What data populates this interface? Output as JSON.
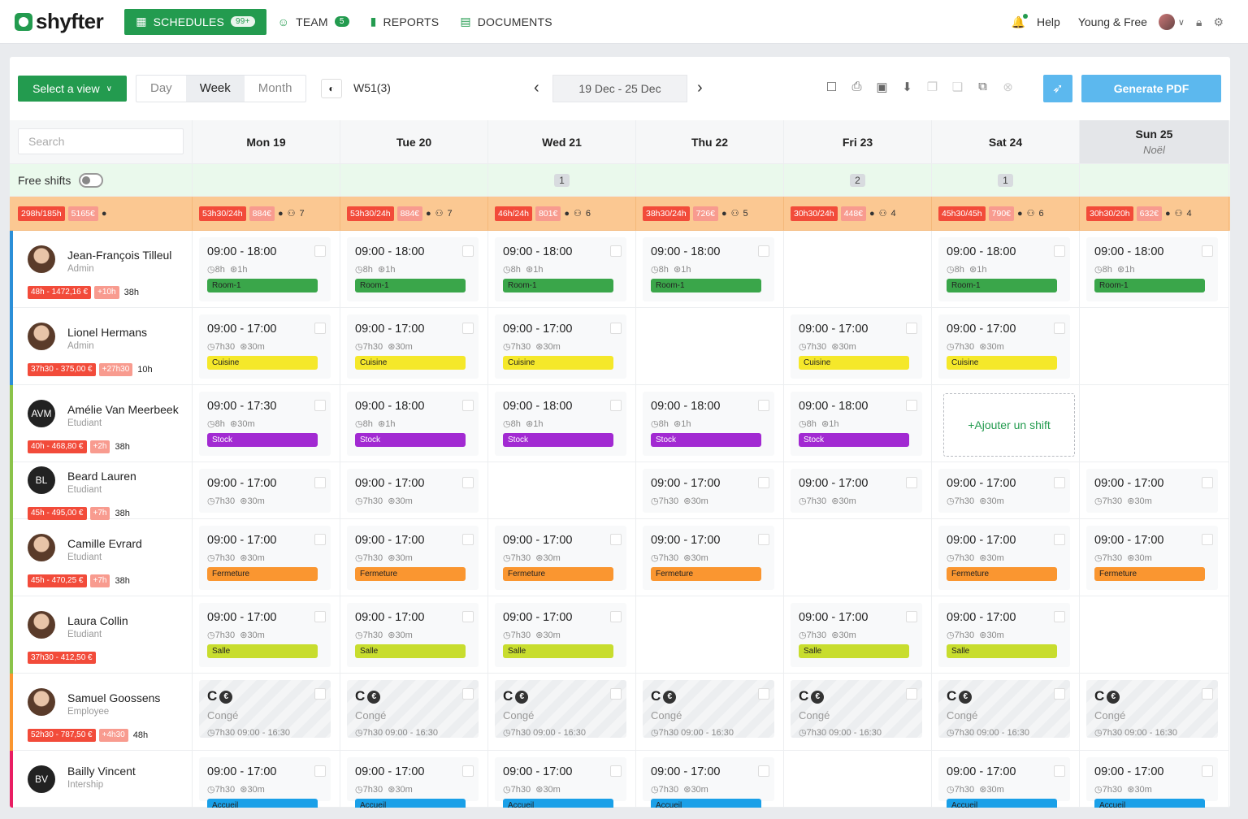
{
  "nav": {
    "logo": "shyfter",
    "schedules": "SCHEDULES",
    "schedules_badge": "99+",
    "team": "TEAM",
    "team_badge": "5",
    "reports": "REPORTS",
    "documents": "DOCUMENTS",
    "help": "Help",
    "org": "Young & Free"
  },
  "toolbar": {
    "select_view": "Select a view",
    "day": "Day",
    "week": "Week",
    "month": "Month",
    "week_label": "W51(3)",
    "date_range": "19 Dec - 25 Dec",
    "generate_pdf": "Generate PDF"
  },
  "search_placeholder": "Search",
  "free_shifts": "Free shifts",
  "days": [
    {
      "label": "Mon 19",
      "sub": "",
      "free": ""
    },
    {
      "label": "Tue 20",
      "sub": "",
      "free": ""
    },
    {
      "label": "Wed 21",
      "sub": "",
      "free": "1"
    },
    {
      "label": "Thu 22",
      "sub": "",
      "free": ""
    },
    {
      "label": "Fri 23",
      "sub": "",
      "free": "2"
    },
    {
      "label": "Sat 24",
      "sub": "",
      "free": "1"
    },
    {
      "label": "Sun 25",
      "sub": "Noël",
      "free": ""
    }
  ],
  "totals": {
    "hours": "298h/185h",
    "cost": "5165€"
  },
  "day_stats": [
    {
      "hours": "53h30/24h",
      "cost": "884€",
      "people": "7"
    },
    {
      "hours": "53h30/24h",
      "cost": "884€",
      "people": "7"
    },
    {
      "hours": "46h/24h",
      "cost": "801€",
      "people": "6"
    },
    {
      "hours": "38h30/24h",
      "cost": "726€",
      "people": "5"
    },
    {
      "hours": "30h30/24h",
      "cost": "448€",
      "people": "4"
    },
    {
      "hours": "45h30/45h",
      "cost": "790€",
      "people": "6"
    },
    {
      "hours": "30h30/20h",
      "cost": "632€",
      "people": "4"
    }
  ],
  "add_shift": "+Ajouter un shift",
  "employees": [
    {
      "name": "Jean-François Tilleul",
      "role": "Admin",
      "initials": "",
      "tags": [
        "48h - 1472,16 €",
        "+10h"
      ],
      "contract": "38h",
      "color": "#2b8fd8",
      "h": 95,
      "shifts": [
        {
          "t": "09:00 - 18:00",
          "d": "8h",
          "b": "1h",
          "l": "Room-1",
          "c": "green"
        },
        {
          "t": "09:00 - 18:00",
          "d": "8h",
          "b": "1h",
          "l": "Room-1",
          "c": "green"
        },
        {
          "t": "09:00 - 18:00",
          "d": "8h",
          "b": "1h",
          "l": "Room-1",
          "c": "green"
        },
        {
          "t": "09:00 - 18:00",
          "d": "8h",
          "b": "1h",
          "l": "Room-1",
          "c": "green"
        },
        null,
        {
          "t": "09:00 - 18:00",
          "d": "8h",
          "b": "1h",
          "l": "Room-1",
          "c": "green"
        },
        {
          "t": "09:00 - 18:00",
          "d": "8h",
          "b": "1h",
          "l": "Room-1",
          "c": "green"
        }
      ]
    },
    {
      "name": "Lionel Hermans",
      "role": "Admin",
      "initials": "",
      "tags": [
        "37h30 - 375,00 €",
        "+27h30"
      ],
      "contract": "10h",
      "color": "#2b8fd8",
      "h": 95,
      "shifts": [
        {
          "t": "09:00 - 17:00",
          "d": "7h30",
          "b": "30m",
          "l": "Cuisine",
          "c": "yellow"
        },
        {
          "t": "09:00 - 17:00",
          "d": "7h30",
          "b": "30m",
          "l": "Cuisine",
          "c": "yellow"
        },
        {
          "t": "09:00 - 17:00",
          "d": "7h30",
          "b": "30m",
          "l": "Cuisine",
          "c": "yellow"
        },
        null,
        {
          "t": "09:00 - 17:00",
          "d": "7h30",
          "b": "30m",
          "l": "Cuisine",
          "c": "yellow"
        },
        {
          "t": "09:00 - 17:00",
          "d": "7h30",
          "b": "30m",
          "l": "Cuisine",
          "c": "yellow"
        },
        null
      ]
    },
    {
      "name": "Amélie Van Meerbeek",
      "role": "Etudiant",
      "initials": "AVM",
      "tags": [
        "40h - 468,80 €",
        "+2h"
      ],
      "contract": "38h",
      "color": "#8bc34a",
      "h": 95,
      "shifts": [
        {
          "t": "09:00 - 17:30",
          "d": "8h",
          "b": "30m",
          "l": "Stock",
          "c": "purple"
        },
        {
          "t": "09:00 - 18:00",
          "d": "8h",
          "b": "1h",
          "l": "Stock",
          "c": "purple"
        },
        {
          "t": "09:00 - 18:00",
          "d": "8h",
          "b": "1h",
          "l": "Stock",
          "c": "purple"
        },
        {
          "t": "09:00 - 18:00",
          "d": "8h",
          "b": "1h",
          "l": "Stock",
          "c": "purple"
        },
        {
          "t": "09:00 - 18:00",
          "d": "8h",
          "b": "1h",
          "l": "Stock",
          "c": "purple"
        },
        "add",
        null
      ]
    },
    {
      "name": "Beard Lauren",
      "role": "Etudiant",
      "initials": "BL",
      "tags": [
        "45h - 495,00 €",
        "+7h"
      ],
      "contract": "38h",
      "color": "#8bc34a",
      "h": 70,
      "shifts": [
        {
          "t": "09:00 - 17:00",
          "d": "7h30",
          "b": "30m",
          "l": "",
          "c": ""
        },
        {
          "t": "09:00 - 17:00",
          "d": "7h30",
          "b": "30m",
          "l": "",
          "c": ""
        },
        null,
        {
          "t": "09:00 - 17:00",
          "d": "7h30",
          "b": "30m",
          "l": "",
          "c": ""
        },
        {
          "t": "09:00 - 17:00",
          "d": "7h30",
          "b": "30m",
          "l": "",
          "c": ""
        },
        {
          "t": "09:00 - 17:00",
          "d": "7h30",
          "b": "30m",
          "l": "",
          "c": ""
        },
        {
          "t": "09:00 - 17:00",
          "d": "7h30",
          "b": "30m",
          "l": "",
          "c": ""
        }
      ]
    },
    {
      "name": "Camille Evrard",
      "role": "Etudiant",
      "initials": "",
      "tags": [
        "45h - 470,25 €",
        "+7h"
      ],
      "contract": "38h",
      "color": "#8bc34a",
      "h": 95,
      "shifts": [
        {
          "t": "09:00 - 17:00",
          "d": "7h30",
          "b": "30m",
          "l": "Fermeture",
          "c": "orange"
        },
        {
          "t": "09:00 - 17:00",
          "d": "7h30",
          "b": "30m",
          "l": "Fermeture",
          "c": "orange"
        },
        {
          "t": "09:00 - 17:00",
          "d": "7h30",
          "b": "30m",
          "l": "Fermeture",
          "c": "orange"
        },
        {
          "t": "09:00 - 17:00",
          "d": "7h30",
          "b": "30m",
          "l": "Fermeture",
          "c": "orange"
        },
        null,
        {
          "t": "09:00 - 17:00",
          "d": "7h30",
          "b": "30m",
          "l": "Fermeture",
          "c": "orange"
        },
        {
          "t": "09:00 - 17:00",
          "d": "7h30",
          "b": "30m",
          "l": "Fermeture",
          "c": "orange"
        }
      ]
    },
    {
      "name": "Laura Collin",
      "role": "Etudiant",
      "initials": "",
      "tags": [
        "37h30 - 412,50 €"
      ],
      "contract": "",
      "color": "#8bc34a",
      "h": 95,
      "shifts": [
        {
          "t": "09:00 - 17:00",
          "d": "7h30",
          "b": "30m",
          "l": "Salle",
          "c": "lime"
        },
        {
          "t": "09:00 - 17:00",
          "d": "7h30",
          "b": "30m",
          "l": "Salle",
          "c": "lime"
        },
        {
          "t": "09:00 - 17:00",
          "d": "7h30",
          "b": "30m",
          "l": "Salle",
          "c": "lime"
        },
        null,
        {
          "t": "09:00 - 17:00",
          "d": "7h30",
          "b": "30m",
          "l": "Salle",
          "c": "lime"
        },
        {
          "t": "09:00 - 17:00",
          "d": "7h30",
          "b": "30m",
          "l": "Salle",
          "c": "lime"
        },
        null
      ]
    },
    {
      "name": "Samuel Goossens",
      "role": "Employee",
      "initials": "",
      "tags": [
        "52h30 - 787,50 €",
        "+4h30"
      ],
      "contract": "48h",
      "color": "#fa9630",
      "h": 95,
      "shifts": [
        {
          "conge": true,
          "l": "Congé",
          "ct": "7h30 09:00 - 16:30"
        },
        {
          "conge": true,
          "l": "Congé",
          "ct": "7h30 09:00 - 16:30"
        },
        {
          "conge": true,
          "l": "Congé",
          "ct": "7h30 09:00 - 16:30"
        },
        {
          "conge": true,
          "l": "Congé",
          "ct": "7h30 09:00 - 16:30"
        },
        {
          "conge": true,
          "l": "Congé",
          "ct": "7h30 09:00 - 16:30"
        },
        {
          "conge": true,
          "l": "Congé",
          "ct": "7h30 09:00 - 16:30"
        },
        {
          "conge": true,
          "l": "Congé",
          "ct": "7h30 09:00 - 16:30"
        }
      ]
    },
    {
      "name": "Bailly Vincent",
      "role": "Intership",
      "initials": "BV",
      "tags": [],
      "contract": "",
      "color": "#e91e63",
      "h": 70,
      "shifts": [
        {
          "t": "09:00 - 17:00",
          "d": "7h30",
          "b": "30m",
          "l": "Accueil",
          "c": "blue"
        },
        {
          "t": "09:00 - 17:00",
          "d": "7h30",
          "b": "30m",
          "l": "Accueil",
          "c": "blue"
        },
        {
          "t": "09:00 - 17:00",
          "d": "7h30",
          "b": "30m",
          "l": "Accueil",
          "c": "blue"
        },
        {
          "t": "09:00 - 17:00",
          "d": "7h30",
          "b": "30m",
          "l": "Accueil",
          "c": "blue"
        },
        null,
        {
          "t": "09:00 - 17:00",
          "d": "7h30",
          "b": "30m",
          "l": "Accueil",
          "c": "blue"
        },
        {
          "t": "09:00 - 17:00",
          "d": "7h30",
          "b": "30m",
          "l": "Accueil",
          "c": "blue"
        }
      ]
    }
  ]
}
